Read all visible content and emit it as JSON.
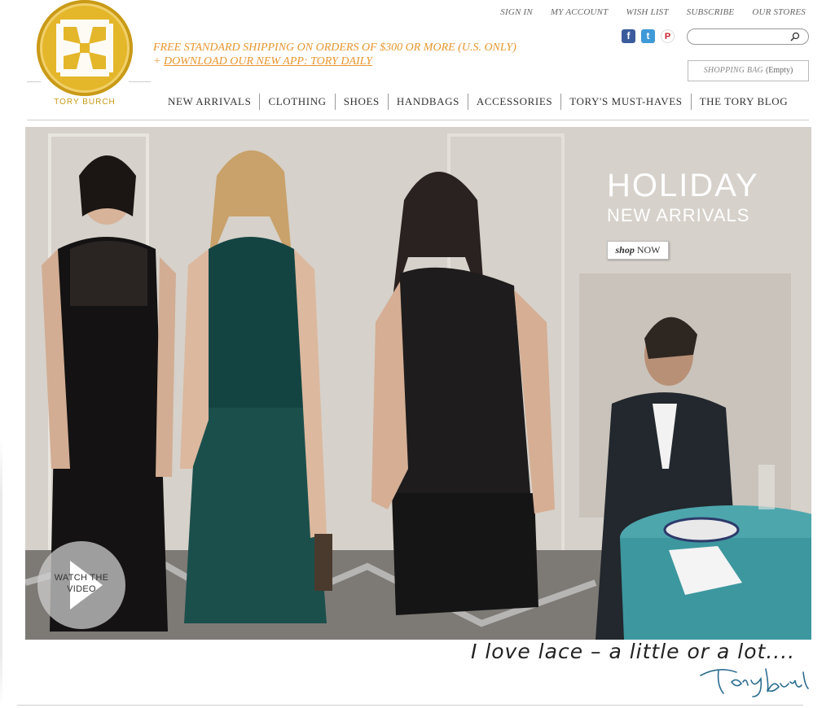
{
  "brand": {
    "logo_text": "TORY BURCH",
    "gold": "#e4b62a"
  },
  "promo": {
    "line1": "FREE STANDARD SHIPPING ON ORDERS OF $300 OR MORE (U.S. ONLY)",
    "line2_prefix": "+ ",
    "line2_link": "DOWNLOAD OUR NEW APP: TORY DAILY",
    "color": "#e8962e"
  },
  "utility_nav": [
    {
      "label": "SIGN IN"
    },
    {
      "label": "MY ACCOUNT"
    },
    {
      "label": "WISH LIST"
    },
    {
      "label": "SUBSCRIBE"
    },
    {
      "label": "OUR STORES"
    }
  ],
  "social": [
    {
      "icon": "facebook-icon",
      "glyph": "f"
    },
    {
      "icon": "twitter-icon",
      "glyph": "t"
    },
    {
      "icon": "pinterest-icon",
      "glyph": "P"
    }
  ],
  "search": {
    "value": "",
    "placeholder": "",
    "icon": "search-icon"
  },
  "shopping_bag": {
    "label": "SHOPPING BAG",
    "status": "(Empty)"
  },
  "main_nav": [
    {
      "label": "NEW ARRIVALS"
    },
    {
      "label": "CLOTHING"
    },
    {
      "label": "SHOES"
    },
    {
      "label": "HANDBAGS"
    },
    {
      "label": "ACCESSORIES"
    },
    {
      "label": "TORY'S MUST-HAVES"
    },
    {
      "label": "THE TORY BLOG"
    }
  ],
  "hero": {
    "title": "HOLIDAY",
    "subtitle": "NEW ARRIVALS",
    "cta_script": "shop",
    "cta_caps": "NOW",
    "video_label": "WATCH THE\nVIDEO",
    "video_icon": "play-icon"
  },
  "footer": {
    "quote": "I love lace – a little or a lot....",
    "signature": "Tory Burch"
  }
}
